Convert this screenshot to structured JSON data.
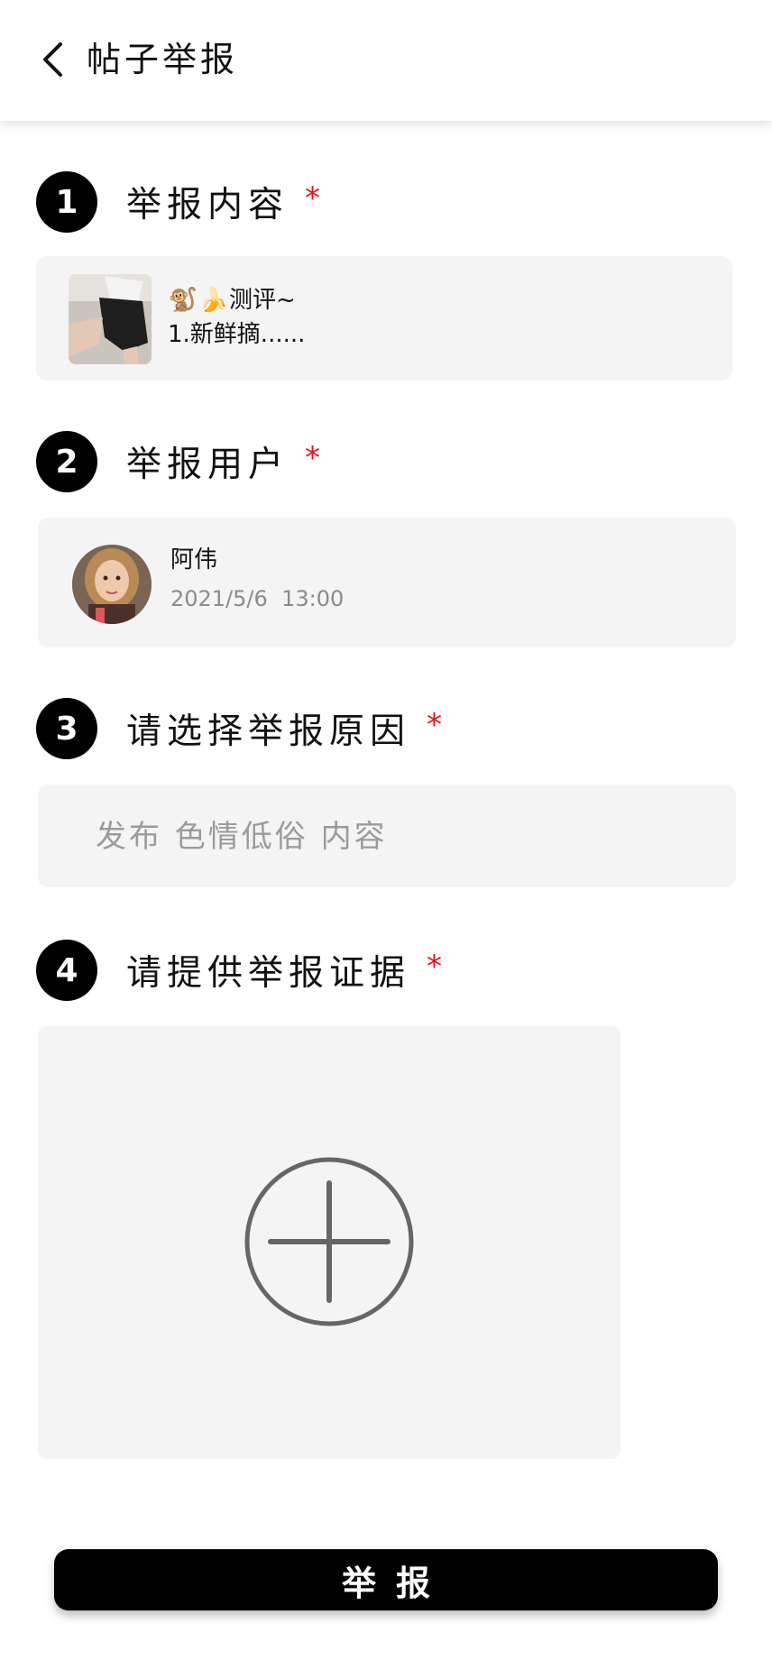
{
  "header": {
    "title": "帖子举报"
  },
  "sections": [
    {
      "number": "1",
      "title": "举报内容",
      "required_mark": "*"
    },
    {
      "number": "2",
      "title": "举报用户",
      "required_mark": "*"
    },
    {
      "number": "3",
      "title": "请选择举报原因",
      "required_mark": "*"
    },
    {
      "number": "4",
      "title": "请提供举报证据",
      "required_mark": "*"
    }
  ],
  "post": {
    "emoji_1": "🐒",
    "emoji_2": "🍌",
    "title_text": "测评~",
    "body_line": "1.新鲜摘......"
  },
  "user": {
    "name": "阿伟",
    "date": "2021/5/6",
    "time": "13:00"
  },
  "reason": {
    "value": "发布 色情低俗 内容"
  },
  "evidence": {
    "add_icon": "plus-circle-icon"
  },
  "submit": {
    "label": "举报"
  },
  "colors": {
    "required": "#e3141b",
    "card_bg": "#f4f4f4",
    "primary": "#000000"
  }
}
